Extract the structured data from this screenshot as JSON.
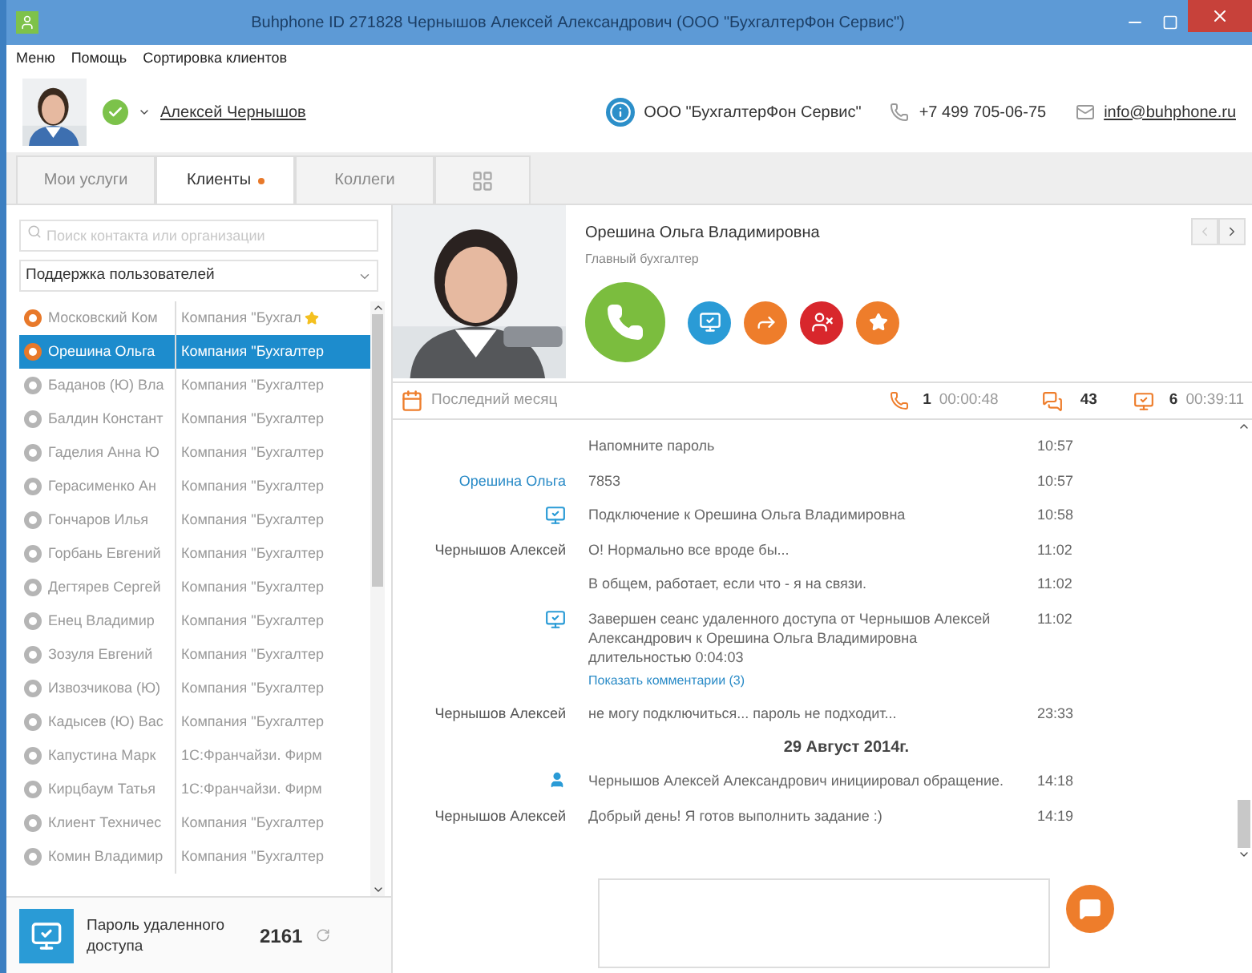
{
  "window": {
    "title": "Buhphone ID 271828 Чернышов Алексей Александрович (ООО \"БухгалтерФон Сервис\")"
  },
  "menu": [
    "Меню",
    "Помощь",
    "Сортировка клиентов"
  ],
  "header": {
    "user": "Алексей Чернышов",
    "online": true,
    "company": "ООО \"БухгалтерФон Сервис\"",
    "phone": "+7 499 705-06-75",
    "email": "info@buhphone.ru"
  },
  "tabs": [
    {
      "label": "Мои услуги",
      "selected": false,
      "dot": false,
      "kind": "text"
    },
    {
      "label": "Клиенты",
      "selected": true,
      "dot": true,
      "kind": "text"
    },
    {
      "label": "Коллеги",
      "selected": false,
      "dot": false,
      "kind": "text"
    },
    {
      "kind": "grid",
      "selected": false,
      "dot": false
    }
  ],
  "search": {
    "placeholder": "Поиск контакта или организации"
  },
  "filter": {
    "value": "Поддержка пользователей"
  },
  "clients": [
    {
      "name": "Московский Ком",
      "company": "Компания \"Бухгал",
      "color": "#e8792a",
      "starred": true,
      "selected": false
    },
    {
      "name": "Орешина Ольга",
      "company": "Компания \"Бухгалтер",
      "color": "#e8792a",
      "starred": false,
      "selected": true
    },
    {
      "name": "Баданов (Ю) Вла",
      "company": "Компания \"Бухгалтер",
      "color": "#b5b5b5",
      "starred": false,
      "selected": false
    },
    {
      "name": "Балдин Констант",
      "company": "Компания \"Бухгалтер",
      "color": "#b5b5b5",
      "starred": false,
      "selected": false
    },
    {
      "name": "Гаделия Анна Ю",
      "company": "Компания \"Бухгалтер",
      "color": "#b5b5b5",
      "starred": false,
      "selected": false
    },
    {
      "name": "Герасименко  Ан",
      "company": "Компания \"Бухгалтер",
      "color": "#b5b5b5",
      "starred": false,
      "selected": false
    },
    {
      "name": "Гончаров Илья",
      "company": "Компания \"Бухгалтер",
      "color": "#b5b5b5",
      "starred": false,
      "selected": false
    },
    {
      "name": "Горбань Евгений",
      "company": "Компания \"Бухгалтер",
      "color": "#b5b5b5",
      "starred": false,
      "selected": false
    },
    {
      "name": "Дегтярев Сергей",
      "company": "Компания \"Бухгалтер",
      "color": "#b5b5b5",
      "starred": false,
      "selected": false
    },
    {
      "name": "Енец Владимир",
      "company": "Компания \"Бухгалтер",
      "color": "#b5b5b5",
      "starred": false,
      "selected": false
    },
    {
      "name": "Зозуля Евгений",
      "company": "Компания \"Бухгалтер",
      "color": "#b5b5b5",
      "starred": false,
      "selected": false
    },
    {
      "name": "Извозчикова (Ю)",
      "company": "Компания \"Бухгалтер",
      "color": "#b5b5b5",
      "starred": false,
      "selected": false
    },
    {
      "name": "Кадысев (Ю) Вас",
      "company": "Компания \"Бухгалтер",
      "color": "#b5b5b5",
      "starred": false,
      "selected": false
    },
    {
      "name": "Капустина Марк",
      "company": "1С:Франчайзи. Фирм",
      "color": "#b5b5b5",
      "starred": false,
      "selected": false
    },
    {
      "name": "Кирцбаум Татья",
      "company": "1С:Франчайзи. Фирм",
      "color": "#b5b5b5",
      "starred": false,
      "selected": false
    },
    {
      "name": "Клиент Техничес",
      "company": "Компания \"Бухгалтер",
      "color": "#b5b5b5",
      "starred": false,
      "selected": false
    },
    {
      "name": "Комин Владимир",
      "company": "Компания \"Бухгалтер",
      "color": "#b5b5b5",
      "starred": false,
      "selected": false
    }
  ],
  "remote_password": {
    "label": "Пароль удаленного доступа",
    "value": "2161"
  },
  "contact": {
    "name": "Орешина Ольга Владимировна",
    "position": "Главный бухгалтер"
  },
  "stats": {
    "period": "Последний месяц",
    "calls": "1",
    "call_time": "00:00:48",
    "messages": "43",
    "sessions": "6",
    "session_time": "00:39:11"
  },
  "chat": [
    {
      "kind": "none",
      "message": "Напомните пароль",
      "time": "10:57"
    },
    {
      "kind": "contact",
      "sender": "Орешина Ольга",
      "message": "7853",
      "time": "10:57"
    },
    {
      "kind": "remote",
      "message": "Подключение к Орешина Ольга Владимировна",
      "time": "10:58"
    },
    {
      "kind": "operator",
      "sender": "Чернышов Алексей",
      "message": "О! Нормально все вроде бы...",
      "time": "11:02"
    },
    {
      "kind": "none",
      "message": "В общем, работает, если что - я на связи.",
      "time": "11:02"
    },
    {
      "kind": "remote",
      "message": "Завершен сеанс удаленного доступа от Чернышов Алексей Александрович к Орешина Ольга Владимировна длительностью 0:04:03",
      "link": "Показать комментарии (3)",
      "time": "11:02"
    },
    {
      "kind": "operator",
      "sender": "Чернышов Алексей",
      "message": "не могу подключиться... пароль не подходит...",
      "time": "23:33"
    },
    {
      "kind": "date",
      "message": "29 Август 2014г."
    },
    {
      "kind": "user",
      "message": "Чернышов Алексей Александрович инициировал обращение.",
      "time": "14:18"
    },
    {
      "kind": "operator",
      "sender": "Чернышов Алексей",
      "message": "Добрый день! Я готов выполнить задание :)",
      "time": "14:19"
    }
  ]
}
